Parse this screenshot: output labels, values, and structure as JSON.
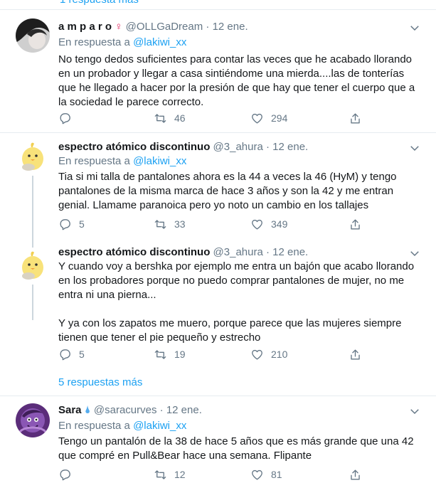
{
  "top_link": "1 respuesta más",
  "reply_prefix": "En respuesta a",
  "tweets": [
    {
      "name": "a m p a r o",
      "name_badge": "♀",
      "handle": "@OLLGaDream",
      "date": "12 ene.",
      "reply_to": "@lakiwi_xx",
      "paragraphs": [
        "No tengo dedos suficientes para contar las veces que he acabado llorando en un probador y llegar a casa sintiéndome una mierda....las de tonterías que he llegado a hacer por la presión de que hay que tener el cuerpo que a la sociedad le parece correcto."
      ],
      "replies": "",
      "retweets": "46",
      "likes": "294"
    },
    {
      "name": "espectro atómico discontinuo",
      "handle": "@3_ahura",
      "date": "12 ene.",
      "reply_to": "@lakiwi_xx",
      "paragraphs": [
        "Tia si mi talla de pantalones ahora es la 44 a veces la 46 (HyM) y tengo pantalones de la misma marca de hace 3 años y son la 42 y me entran genial. Llamame paranoica pero yo noto un cambio en los tallajes"
      ],
      "replies": "5",
      "retweets": "33",
      "likes": "349"
    },
    {
      "name": "espectro atómico discontinuo",
      "handle": "@3_ahura",
      "date": "12 ene.",
      "paragraphs": [
        "Y cuando voy a bershka por ejemplo me entra un bajón que acabo llorando en los probadores porque no puedo comprar pantalones de mujer, no me entra ni una pierna...",
        "Y ya con los zapatos me muero, porque parece que las mujeres siempre tienen que tener el pie pequeño y estrecho"
      ],
      "replies": "5",
      "retweets": "19",
      "likes": "210",
      "more_replies": "5 respuestas más"
    },
    {
      "name": "Sara",
      "name_badge": "🌢",
      "handle": "@saracurves",
      "date": "12 ene.",
      "reply_to": "@lakiwi_xx",
      "paragraphs": [
        "Tengo un pantalón de la 38 de hace 5 años que es más grande que una 42 que compré en Pull&Bear hace una semana. Flipante"
      ],
      "replies": "",
      "retweets": "12",
      "likes": "81"
    }
  ],
  "colors": {
    "accent": "#1da1f2",
    "muted": "#657786",
    "text": "#14171a",
    "border": "#e6ecf0",
    "venus": "#e0245e"
  }
}
